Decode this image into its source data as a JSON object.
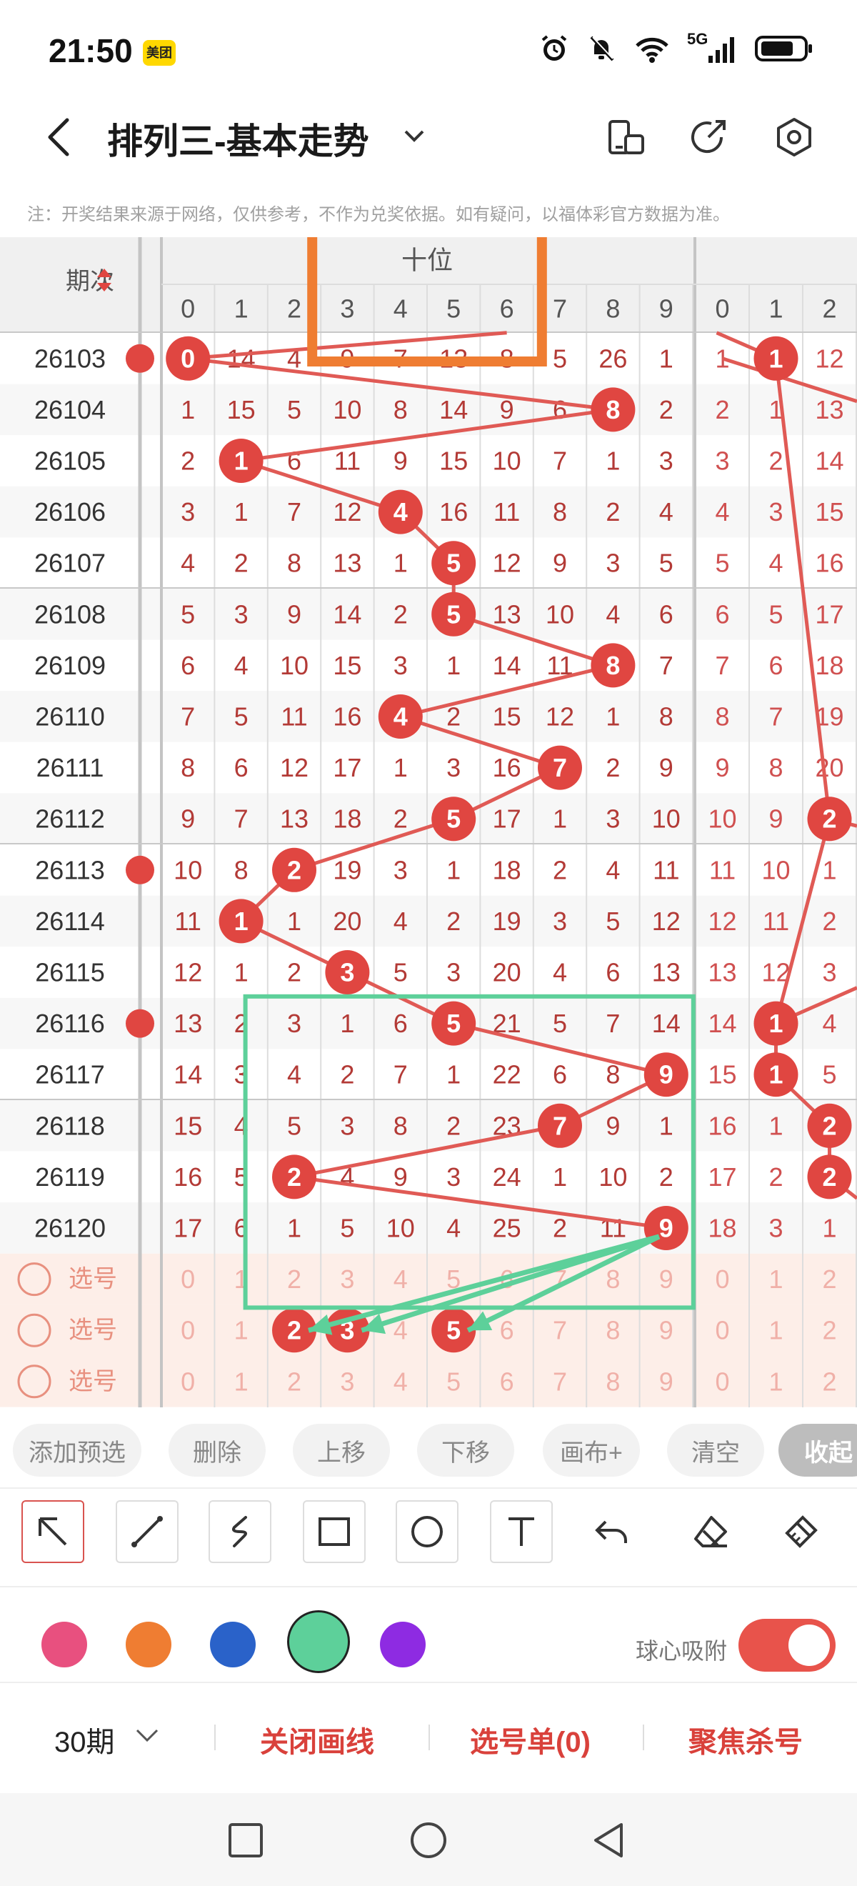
{
  "status": {
    "time": "21:50",
    "app_badge": "美团",
    "network": "5G"
  },
  "nav": {
    "title": "排列三-基本走势"
  },
  "notice": "注：开奖结果来源于网络，仅供参考，不作为兑奖依据。如有疑问，以福体彩官方数据为准。",
  "grid": {
    "period_header": "期次",
    "group_label": "十位",
    "digits": [
      "0",
      "1",
      "2",
      "3",
      "4",
      "5",
      "6",
      "7",
      "8",
      "9"
    ],
    "next_digits": [
      "0",
      "1",
      "2"
    ],
    "rows": [
      {
        "period": "26103",
        "cells": [
          "0",
          "14",
          "4",
          "9",
          "7",
          "13",
          "8",
          "5",
          "26",
          "1"
        ],
        "next": [
          "1",
          "1",
          "12"
        ]
      },
      {
        "period": "26104",
        "cells": [
          "1",
          "15",
          "5",
          "10",
          "8",
          "14",
          "9",
          "6",
          "8",
          "2"
        ],
        "next": [
          "2",
          "1",
          "13"
        ]
      },
      {
        "period": "26105",
        "cells": [
          "2",
          "1",
          "6",
          "11",
          "9",
          "15",
          "10",
          "7",
          "1",
          "3"
        ],
        "next": [
          "3",
          "2",
          "14"
        ]
      },
      {
        "period": "26106",
        "cells": [
          "3",
          "1",
          "7",
          "12",
          "4",
          "16",
          "11",
          "8",
          "2",
          "4"
        ],
        "next": [
          "4",
          "3",
          "15"
        ]
      },
      {
        "period": "26107",
        "cells": [
          "4",
          "2",
          "8",
          "13",
          "1",
          "5",
          "12",
          "9",
          "3",
          "5"
        ],
        "next": [
          "5",
          "4",
          "16"
        ]
      },
      {
        "period": "26108",
        "cells": [
          "5",
          "3",
          "9",
          "14",
          "2",
          "5",
          "13",
          "10",
          "4",
          "6"
        ],
        "next": [
          "6",
          "5",
          "17"
        ]
      },
      {
        "period": "26109",
        "cells": [
          "6",
          "4",
          "10",
          "15",
          "3",
          "1",
          "14",
          "11",
          "8",
          "7"
        ],
        "next": [
          "7",
          "6",
          "18"
        ]
      },
      {
        "period": "26110",
        "cells": [
          "7",
          "5",
          "11",
          "16",
          "4",
          "2",
          "15",
          "12",
          "1",
          "8"
        ],
        "next": [
          "8",
          "7",
          "19"
        ]
      },
      {
        "period": "26111",
        "cells": [
          "8",
          "6",
          "12",
          "17",
          "1",
          "3",
          "16",
          "7",
          "2",
          "9"
        ],
        "next": [
          "9",
          "8",
          "20"
        ]
      },
      {
        "period": "26112",
        "cells": [
          "9",
          "7",
          "13",
          "18",
          "2",
          "5",
          "17",
          "1",
          "3",
          "10"
        ],
        "next": [
          "10",
          "9",
          "2"
        ]
      },
      {
        "period": "26113",
        "cells": [
          "10",
          "8",
          "2",
          "19",
          "3",
          "1",
          "18",
          "2",
          "4",
          "11"
        ],
        "next": [
          "11",
          "10",
          "1"
        ]
      },
      {
        "period": "26114",
        "cells": [
          "11",
          "1",
          "1",
          "20",
          "4",
          "2",
          "19",
          "3",
          "5",
          "12"
        ],
        "next": [
          "12",
          "11",
          "2"
        ]
      },
      {
        "period": "26115",
        "cells": [
          "12",
          "1",
          "2",
          "3",
          "5",
          "3",
          "20",
          "4",
          "6",
          "13"
        ],
        "next": [
          "13",
          "12",
          "3"
        ]
      },
      {
        "period": "26116",
        "cells": [
          "13",
          "2",
          "3",
          "1",
          "6",
          "5",
          "21",
          "5",
          "7",
          "14"
        ],
        "next": [
          "14",
          "1",
          "4"
        ]
      },
      {
        "period": "26117",
        "cells": [
          "14",
          "3",
          "4",
          "2",
          "7",
          "1",
          "22",
          "6",
          "8",
          "9"
        ],
        "next": [
          "15",
          "1",
          "5"
        ]
      },
      {
        "period": "26118",
        "cells": [
          "15",
          "4",
          "5",
          "3",
          "8",
          "2",
          "23",
          "7",
          "9",
          "1"
        ],
        "next": [
          "16",
          "1",
          "2"
        ]
      },
      {
        "period": "26119",
        "cells": [
          "16",
          "5",
          "2",
          "4",
          "9",
          "3",
          "24",
          "1",
          "10",
          "2"
        ],
        "next": [
          "17",
          "2",
          "2"
        ]
      },
      {
        "period": "26120",
        "cells": [
          "17",
          "6",
          "1",
          "5",
          "10",
          "4",
          "25",
          "2",
          "11",
          "9"
        ],
        "next": [
          "18",
          "3",
          "1"
        ]
      }
    ],
    "ball_columns": [
      0,
      8,
      1,
      4,
      5,
      5,
      8,
      4,
      7,
      5,
      2,
      1,
      3,
      5,
      9,
      7,
      2,
      9
    ],
    "next_balls": [
      {
        "row": 0,
        "col": 1
      },
      {
        "row": 9,
        "col": 2
      },
      {
        "row": 13,
        "col": 1
      },
      {
        "row": 14,
        "col": 1
      },
      {
        "row": 15,
        "col": 2
      },
      {
        "row": 16,
        "col": 2
      }
    ],
    "select_label": "选号",
    "selected_picks": [
      2,
      3,
      5
    ]
  },
  "toolbar": {
    "add_preselect": "添加预选",
    "delete": "删除",
    "move_up": "上移",
    "move_down": "下移",
    "canvas_plus": "画布+",
    "clear": "清空",
    "collapse": "收起"
  },
  "tools": [
    "select-arrow",
    "line",
    "curve",
    "rectangle",
    "circle",
    "text",
    "undo",
    "eraser",
    "brush"
  ],
  "colors": {
    "pink": "#e8507f",
    "orange": "#ef7d32",
    "blue": "#2a62c9",
    "green": "#5dd09a",
    "purple": "#8e2be2",
    "accent_red": "#e04641"
  },
  "snap": {
    "label": "球心吸附",
    "on": true
  },
  "bottom": {
    "periods": "30期",
    "close_drawing": "关闭画线",
    "pick_list": "选号单(0)",
    "focus_kill": "聚焦杀号"
  }
}
